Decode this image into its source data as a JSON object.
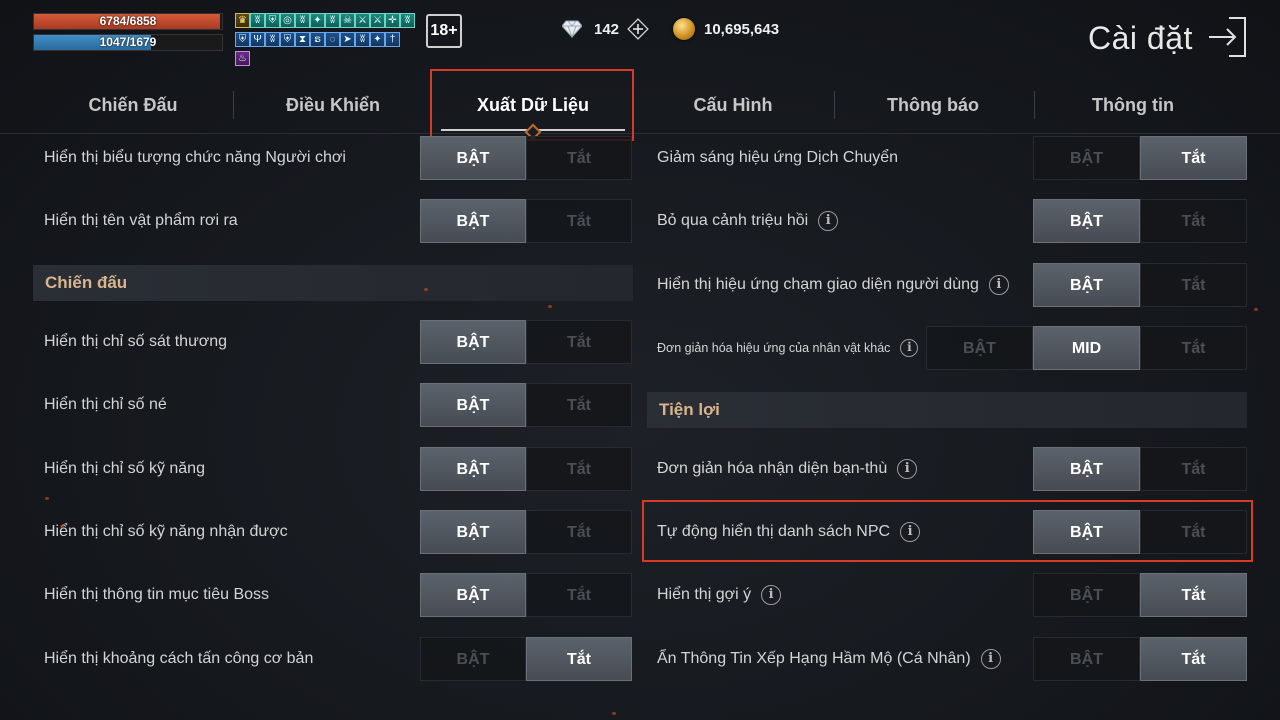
{
  "hud": {
    "hp_text": "6784/6858",
    "hp_fraction": 0.989,
    "mp_text": "1047/1679",
    "mp_fraction": 0.624,
    "age_rating": "18+",
    "diamonds": "142",
    "gold": "10,695,643",
    "buff_icons": [
      "trophy-icon",
      "wing-icon",
      "shield-icon",
      "target-icon",
      "wing-icon",
      "star-icon",
      "wing-icon",
      "skull-icon",
      "sword-icon",
      "sword-icon",
      "cross-icon",
      "wing-icon",
      "shield-icon",
      "trident-icon",
      "wing-icon",
      "shield-icon",
      "hourglass-icon",
      "swirl-icon",
      "spiral-icon",
      "arrow-icon",
      "wing-icon",
      "star-icon",
      "dagger-icon",
      "flame-icon"
    ]
  },
  "page_title": "Cài đặt",
  "tabs": [
    {
      "label": "Chiến Đấu",
      "active": false
    },
    {
      "label": "Điều Khiển",
      "active": false
    },
    {
      "label": "Xuất Dữ Liệu",
      "active": true
    },
    {
      "label": "Cấu Hình",
      "active": false
    },
    {
      "label": "Thông báo",
      "active": false
    },
    {
      "label": "Thông tin",
      "active": false
    }
  ],
  "left_column": {
    "rows_top": [
      {
        "label": "Hiển thị biểu tượng chức năng Người chơi",
        "on": "BẬT",
        "off": "Tắt",
        "state": "on"
      },
      {
        "label": "Hiển thị tên vật phẩm rơi ra",
        "on": "BẬT",
        "off": "Tắt",
        "state": "on"
      }
    ],
    "section": "Chiến đấu",
    "rows": [
      {
        "label": "Hiển thị chỉ số sát thương",
        "on": "BẬT",
        "off": "Tắt",
        "state": "on"
      },
      {
        "label": "Hiển thị chỉ số né",
        "on": "BẬT",
        "off": "Tắt",
        "state": "on"
      },
      {
        "label": "Hiển thị chỉ số kỹ năng",
        "on": "BẬT",
        "off": "Tắt",
        "state": "on"
      },
      {
        "label": "Hiển thị chỉ số kỹ năng nhận được",
        "on": "BẬT",
        "off": "Tắt",
        "state": "on"
      },
      {
        "label": "Hiển thị thông tin mục tiêu Boss",
        "on": "BẬT",
        "off": "Tắt",
        "state": "on"
      },
      {
        "label": "Hiển thị khoảng cách tấn công cơ bản",
        "on": "BẬT",
        "off": "Tắt",
        "state": "off"
      }
    ]
  },
  "right_column": {
    "rows_top": [
      {
        "label": "Giảm sáng hiệu ứng Dịch Chuyển",
        "on": "BẬT",
        "off": "Tắt",
        "state": "off",
        "info": false
      },
      {
        "label": "Bỏ qua cảnh triệu hồi",
        "on": "BẬT",
        "off": "Tắt",
        "state": "on",
        "info": true
      },
      {
        "label": "Hiển thị hiệu ứng chạm giao diện người dùng",
        "on": "BẬT",
        "off": "Tắt",
        "state": "on",
        "info": true
      }
    ],
    "triple_row": {
      "label": "Đơn giản hóa hiệu ứng của nhân vật khác",
      "on": "BẬT",
      "mid": "MID",
      "off": "Tắt",
      "state": "mid"
    },
    "section": "Tiện lợi",
    "rows": [
      {
        "label": "Đơn giản hóa nhận diện bạn-thù",
        "on": "BẬT",
        "off": "Tắt",
        "state": "on",
        "info": true
      },
      {
        "label": "Tự động hiển thị danh sách NPC",
        "on": "BẬT",
        "off": "Tắt",
        "state": "on",
        "info": true
      },
      {
        "label": "Hiển thị gợi ý",
        "on": "BẬT",
        "off": "Tắt",
        "state": "off",
        "info": true
      },
      {
        "label": "Ẩn Thông Tin Xếp Hạng Hầm Mộ (Cá Nhân)",
        "on": "BẬT",
        "off": "Tắt",
        "state": "off",
        "info": true
      }
    ]
  },
  "colors": {
    "highlight": "#d93a26",
    "section_text": "#d9b58c",
    "toggle_on": "#5c626b"
  }
}
